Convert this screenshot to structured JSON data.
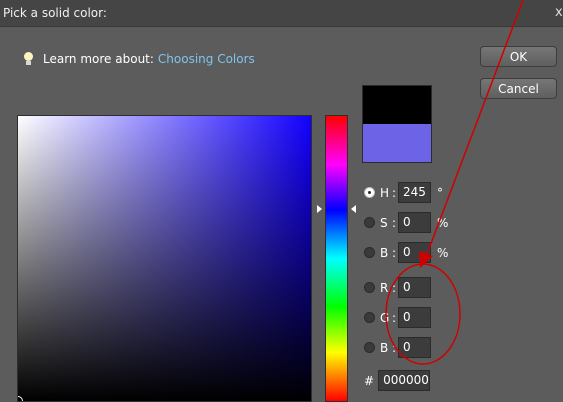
{
  "window": {
    "title": "Pick a solid color:",
    "close_glyph": "x"
  },
  "learn": {
    "label": "Learn more about:",
    "link": "Choosing Colors",
    "icon": "lightbulb-icon"
  },
  "buttons": {
    "ok": "OK",
    "cancel": "Cancel"
  },
  "swatch": {
    "new_color": "#000000",
    "current_color": "#6c63e6"
  },
  "fields": {
    "h": {
      "label": "H",
      "value": "245",
      "unit": "°",
      "selected": true
    },
    "s": {
      "label": "S",
      "value": "0",
      "unit": "%"
    },
    "b": {
      "label": "B",
      "value": "0",
      "unit": "%"
    },
    "r": {
      "label": "R",
      "value": "0"
    },
    "g": {
      "label": "G",
      "value": "0"
    },
    "b2": {
      "label": "B",
      "value": "0"
    }
  },
  "hex": {
    "hash": "#",
    "value": "000000"
  },
  "colors": {
    "hue_color": "#1300ff",
    "annotation": "#d00000"
  }
}
